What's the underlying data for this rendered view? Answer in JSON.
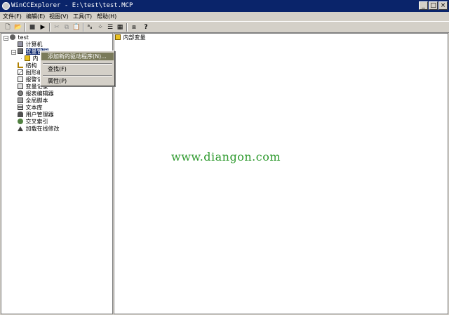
{
  "window": {
    "title": "WinCCExplorer - E:\\test\\test.MCP",
    "minimize_glyph": "_",
    "maximize_glyph": "□",
    "close_glyph": "×"
  },
  "menubar": {
    "items": [
      "文件(F)",
      "编辑(E)",
      "视图(V)",
      "工具(T)",
      "帮助(H)"
    ]
  },
  "toolbar": {
    "glyphs": {
      "new": "🗋",
      "open": "📂",
      "stop": "■",
      "run": "▶",
      "cut": "✂",
      "copy": "⧉",
      "paste": "📋",
      "small_icons": "ᵃₐ",
      "large_icons": "⁘",
      "list": "☰",
      "details": "▦",
      "properties": "⧈",
      "help": "?"
    }
  },
  "tree": {
    "root": "test",
    "items": [
      {
        "label": "计算机"
      },
      {
        "label": "变量管理"
      },
      {
        "label": "内"
      },
      {
        "label": "结构"
      },
      {
        "label": "图形编"
      },
      {
        "label": "报警记"
      },
      {
        "label": "变量记录"
      },
      {
        "label": "报表编辑器"
      },
      {
        "label": "全局脚本"
      },
      {
        "label": "文本库"
      },
      {
        "label": "用户管理器"
      },
      {
        "label": "交叉索引"
      },
      {
        "label": "加载在线修改"
      }
    ]
  },
  "context_menu": {
    "items": [
      "添加新的驱动程序(N)...",
      "查找(F)",
      "属性(P)"
    ]
  },
  "right_pane": {
    "item": "内部变量"
  },
  "watermark": "www.diangon.com"
}
